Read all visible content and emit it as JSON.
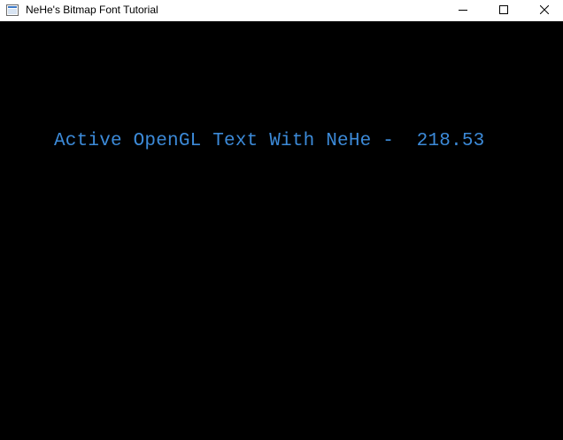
{
  "window": {
    "title": "NeHe's Bitmap Font Tutorial",
    "icon": "app-window-icon",
    "controls": {
      "minimize_icon": "minimize-icon",
      "maximize_icon": "maximize-icon",
      "close_icon": "close-icon"
    }
  },
  "scene": {
    "background_color": "#000000",
    "text_color": "#3c8ad8",
    "message": "Active OpenGL Text With NeHe -  218.53"
  }
}
